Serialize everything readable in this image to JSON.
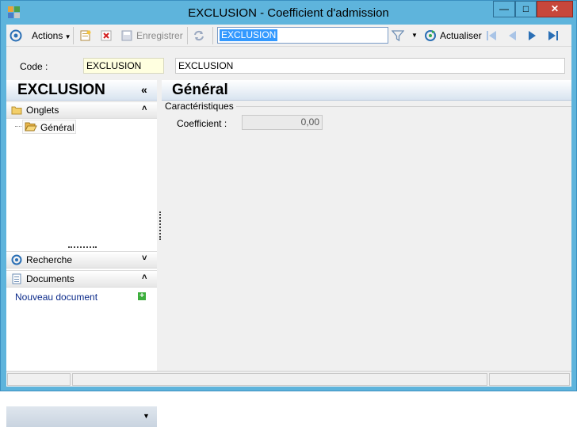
{
  "window": {
    "title": "EXCLUSION -  Coefficient d'admission",
    "minimize_glyph": "—",
    "maximize_glyph": "□",
    "close_glyph": "✕"
  },
  "toolbar": {
    "actions_label": "Actions",
    "save_label": "Enregistrer",
    "search_value": "EXCLUSION",
    "refresh_label": "Actualiser",
    "icons": [
      "target-icon",
      "new-record-icon",
      "delete-icon",
      "save-icon",
      "refresh-arrows-icon",
      "filter-icon",
      "refresh-icon",
      "first-record-icon",
      "previous-record-icon",
      "next-record-icon",
      "last-record-icon"
    ]
  },
  "record": {
    "code_label": "Code :",
    "code_value": "EXCLUSION",
    "description_value": "EXCLUSION"
  },
  "left_panel": {
    "title": "EXCLUSION",
    "collapse_glyph": "«",
    "sections": {
      "onglets": {
        "label": "Onglets",
        "chevron": "˄"
      },
      "recherche": {
        "label": "Recherche",
        "chevron": "˅"
      },
      "documents": {
        "label": "Documents",
        "chevron": "˄"
      }
    },
    "tree_item_label": "Général",
    "new_document_label": "Nouveau document",
    "bottom_chevron": "▼"
  },
  "main": {
    "title": "Général",
    "group_label": "Caractéristiques",
    "coefficient_label": "Coefficient :",
    "coefficient_value": "0,00"
  },
  "colors": {
    "title_bar": "#5eb4dc",
    "close_button": "#c7473b",
    "accent_blue": "#2a6fb5",
    "code_field_bg": "#ffffe0"
  }
}
